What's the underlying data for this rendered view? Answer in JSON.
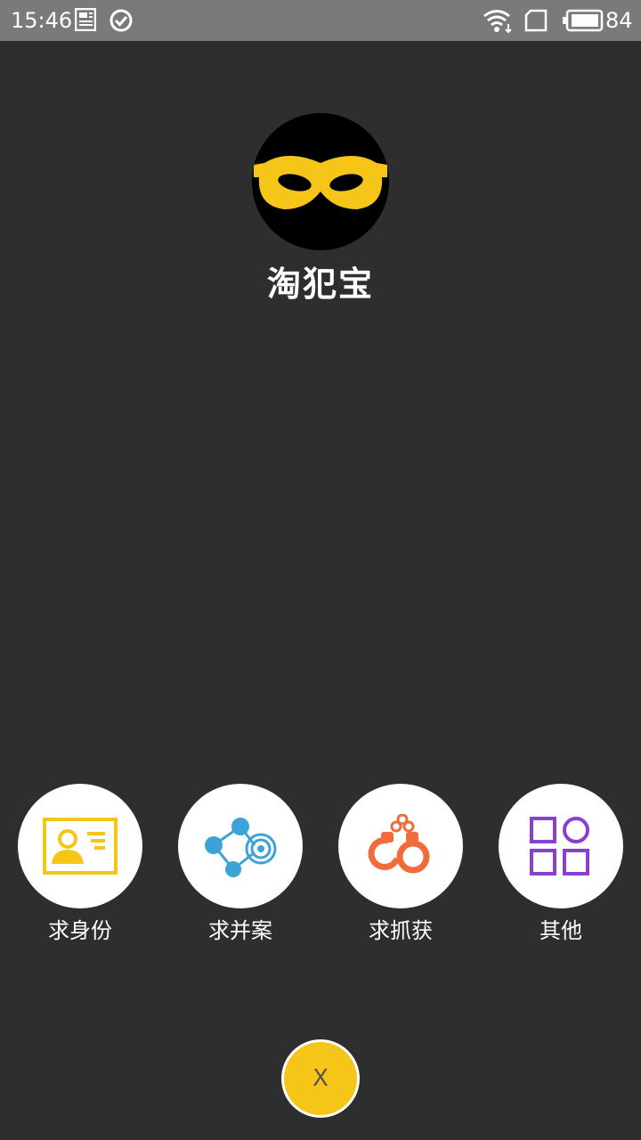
{
  "status_bar": {
    "time": "15:46",
    "battery": "84",
    "icons": [
      "news-icon",
      "check-circle-icon",
      "wifi-icon",
      "sim-card-icon",
      "battery-icon"
    ]
  },
  "app": {
    "name": "淘犯宝",
    "logo_icon": "masked-face-icon"
  },
  "actions": [
    {
      "label": "求身份",
      "icon": "id-card-icon",
      "color": "#f5c518"
    },
    {
      "label": "求并案",
      "icon": "network-target-icon",
      "color": "#3ba3d9"
    },
    {
      "label": "求抓获",
      "icon": "handcuffs-icon",
      "color": "#f26b3a"
    },
    {
      "label": "其他",
      "icon": "grid-apps-icon",
      "color": "#8a3fd1"
    }
  ],
  "close_button": {
    "label": "X",
    "color": "#f5c518"
  }
}
